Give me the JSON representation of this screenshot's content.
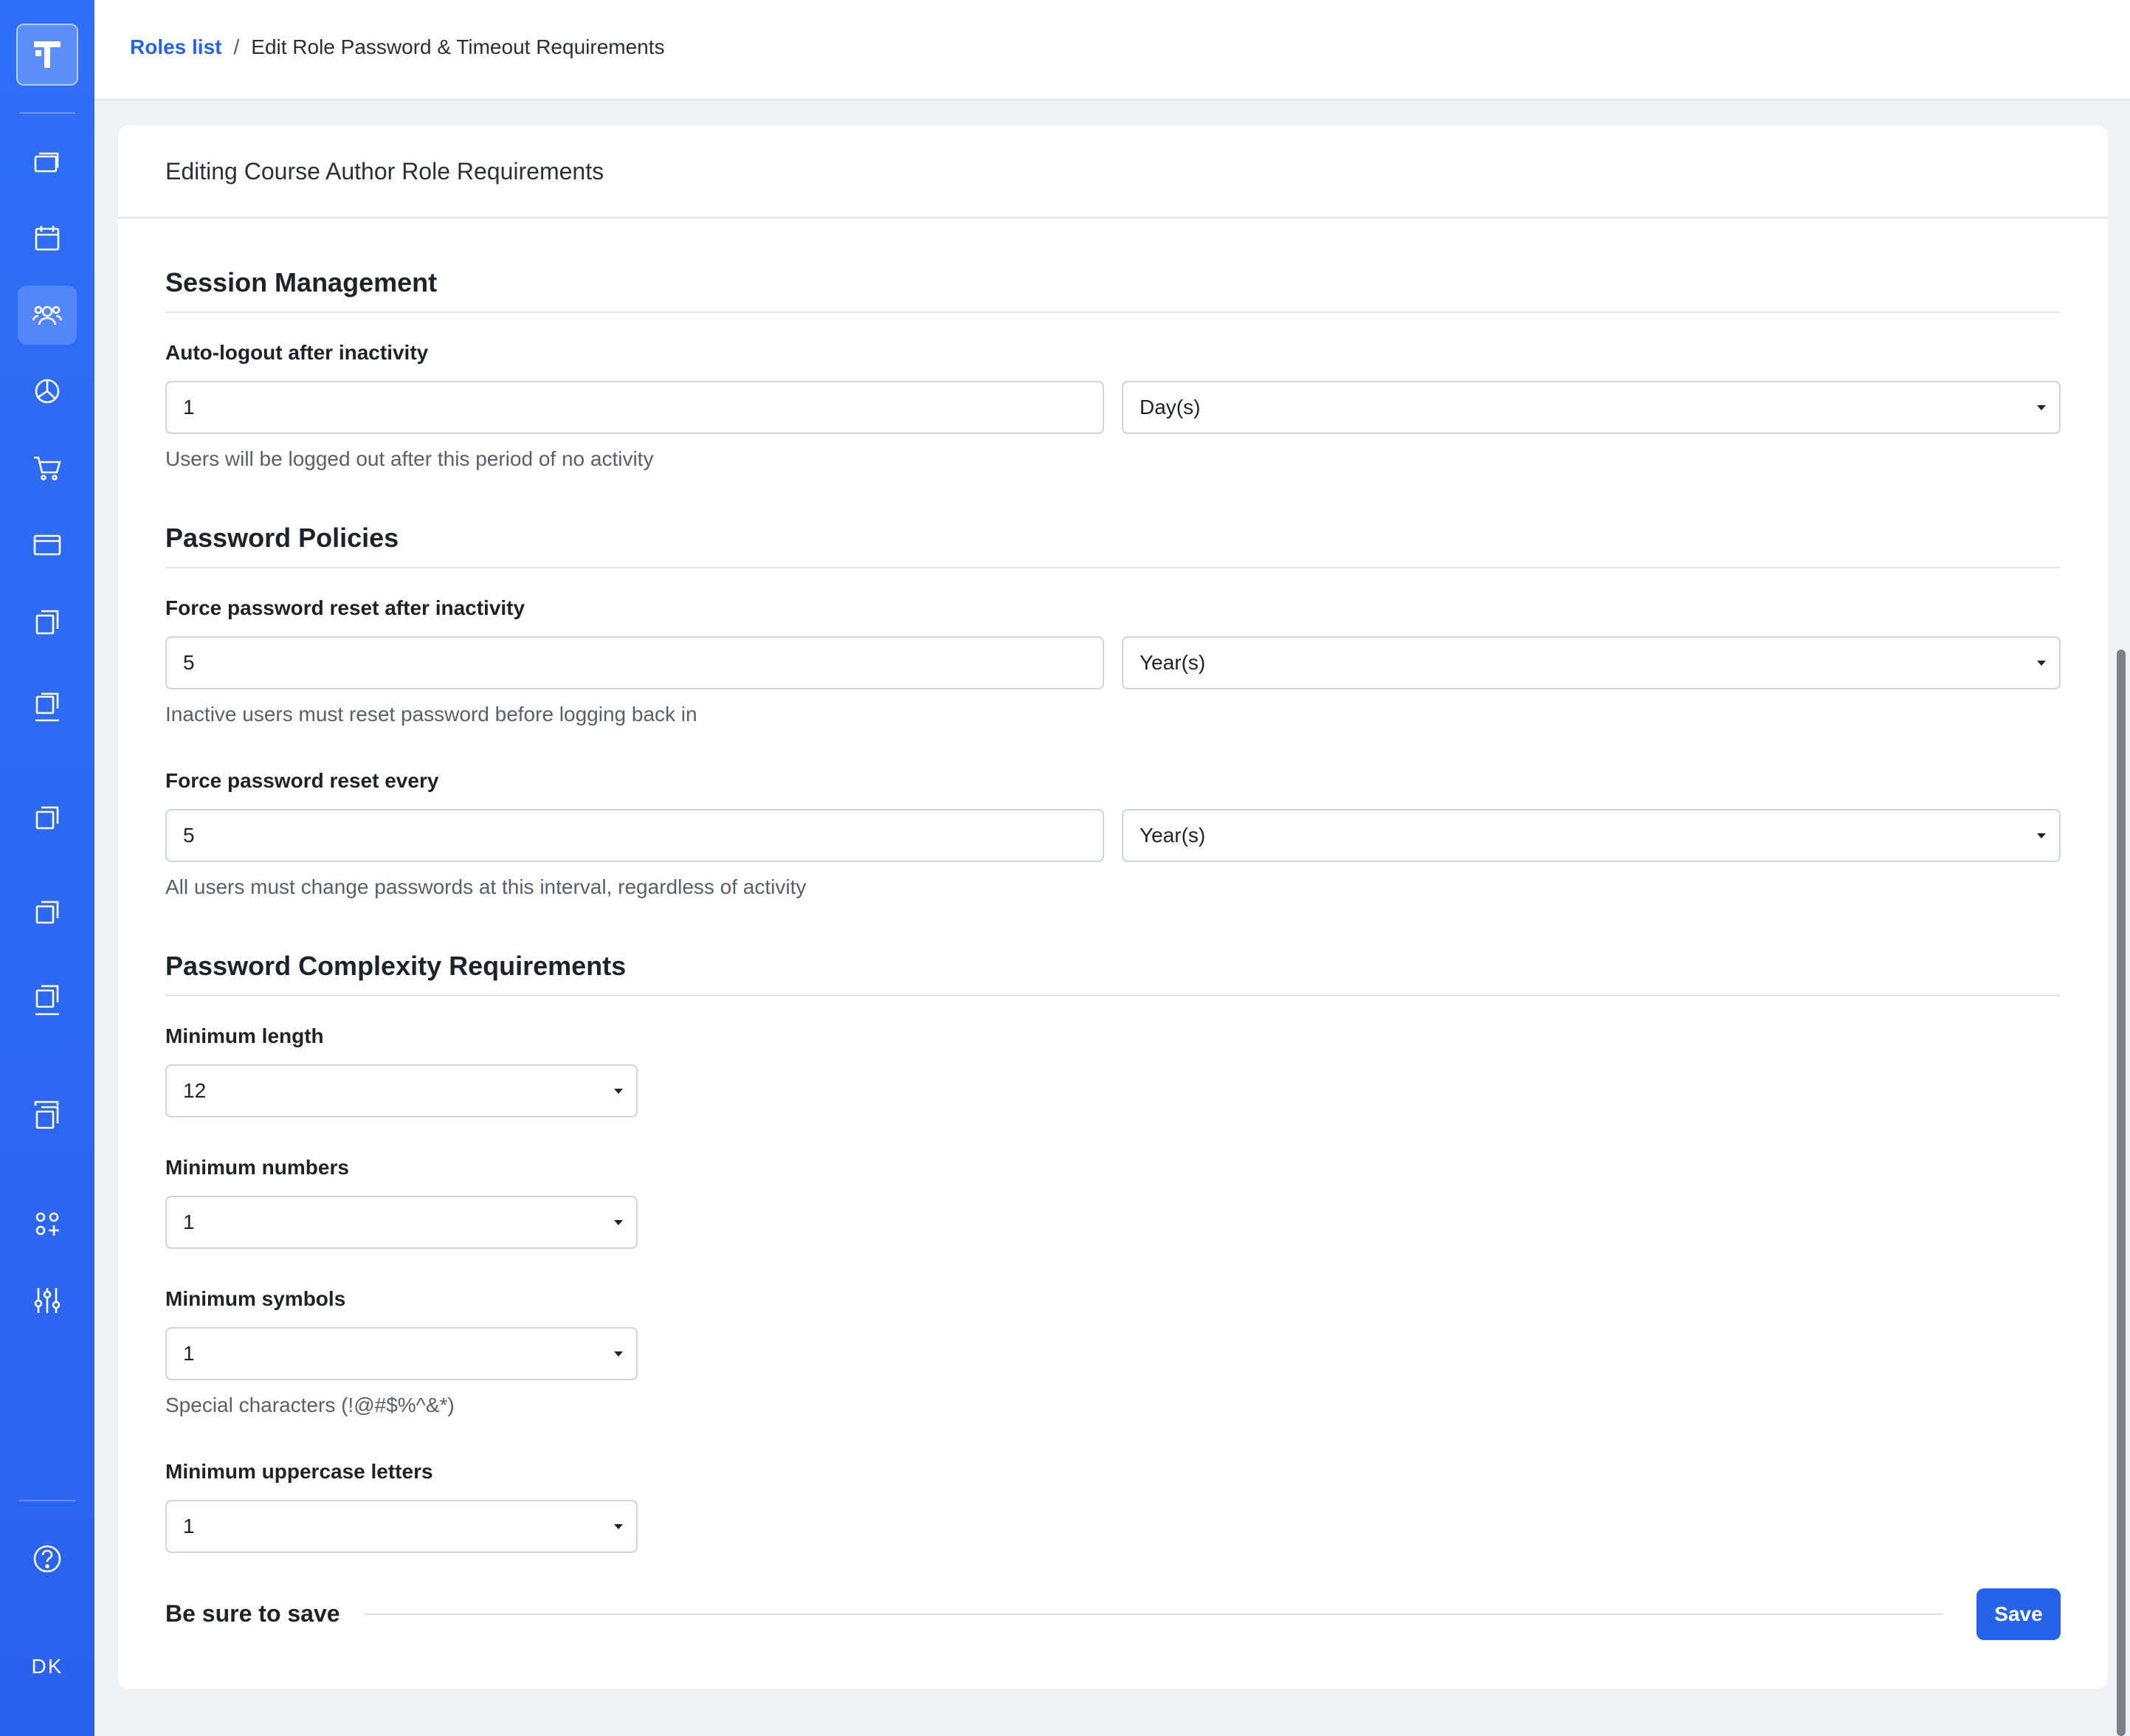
{
  "sidebar": {
    "logo_icon": "brand-logo-icon",
    "items": [
      {
        "icon": "courses-icon"
      },
      {
        "icon": "calendar-icon"
      },
      {
        "icon": "users-icon",
        "active": true
      },
      {
        "icon": "reports-icon"
      },
      {
        "icon": "cart-icon"
      },
      {
        "icon": "card-icon"
      },
      {
        "icon": "pages-icon"
      },
      {
        "icon": "pages-alt-icon"
      },
      {
        "icon": "copy-icon"
      },
      {
        "icon": "copy-alt-icon"
      },
      {
        "icon": "copy-stack-icon"
      },
      {
        "icon": "library-icon"
      },
      {
        "icon": "integrations-icon"
      },
      {
        "icon": "settings-sliders-icon"
      }
    ],
    "help_icon": "help-circle-icon",
    "user_initials": "DK",
    "accent_color": "#2f6ef6"
  },
  "breadcrumb": {
    "parent": "Roles list",
    "separator": "/",
    "current": "Edit Role Password & Timeout Requirements"
  },
  "card": {
    "title": "Editing Course Author Role Requirements"
  },
  "session": {
    "title": "Session Management",
    "auto_logout": {
      "label": "Auto-logout after inactivity",
      "value": "1",
      "unit": "Day(s)",
      "help": "Users will be logged out after this period of no activity"
    }
  },
  "password": {
    "title": "Password Policies",
    "reset_inactivity": {
      "label": "Force password reset after inactivity",
      "value": "5",
      "unit": "Year(s)",
      "help": "Inactive users must reset password before logging back in"
    },
    "reset_every": {
      "label": "Force password reset every",
      "value": "5",
      "unit": "Year(s)",
      "help": "All users must change passwords at this interval, regardless of activity"
    }
  },
  "complexity": {
    "title": "Password Complexity Requirements",
    "min_length": {
      "label": "Minimum length",
      "value": "12"
    },
    "min_numbers": {
      "label": "Minimum numbers",
      "value": "1"
    },
    "min_symbols": {
      "label": "Minimum symbols",
      "value": "1",
      "help": "Special characters (!@#$%^&*)"
    },
    "min_uppercase": {
      "label": "Minimum uppercase letters",
      "value": "1"
    }
  },
  "footer": {
    "reminder": "Be sure to save",
    "save_label": "Save",
    "primary_color": "#2563eb"
  }
}
